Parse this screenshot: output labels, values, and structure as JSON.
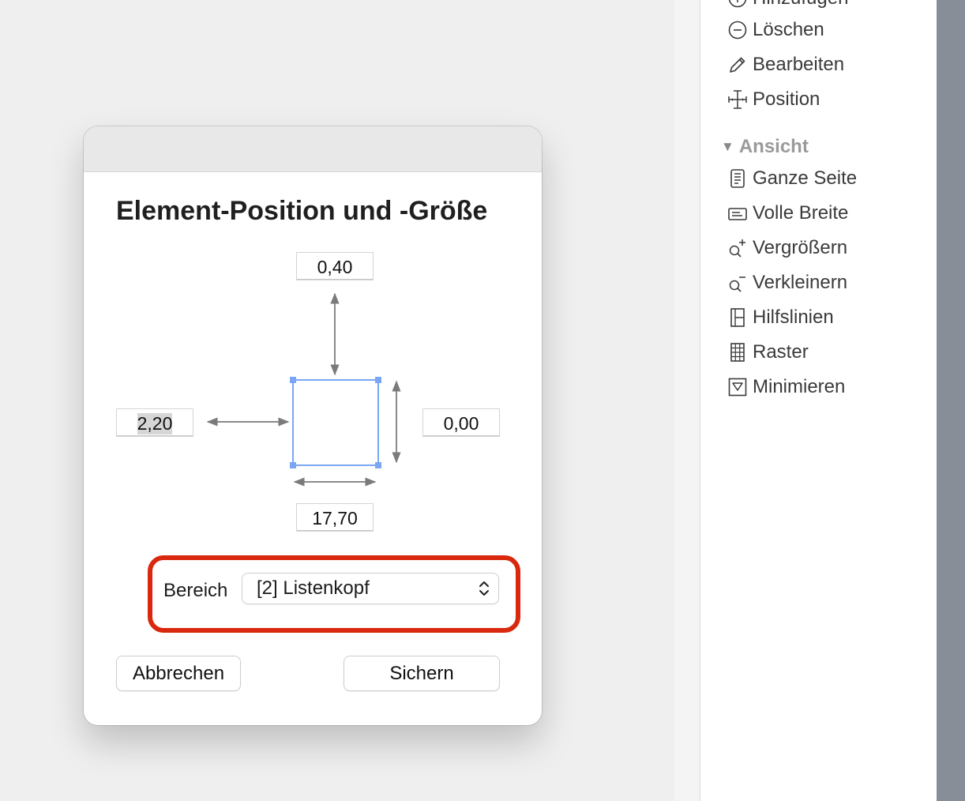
{
  "sidebar": {
    "items_top": [
      {
        "label": "Hinzufügen",
        "icon": "plus-circle-icon"
      },
      {
        "label": "Löschen",
        "icon": "minus-circle-icon"
      },
      {
        "label": "Bearbeiten",
        "icon": "pencil-icon"
      },
      {
        "label": "Position",
        "icon": "position-icon"
      }
    ],
    "section": {
      "label": "Ansicht",
      "icon": "disclosure-triangle-icon"
    },
    "items_view": [
      {
        "label": "Ganze Seite",
        "icon": "full-page-icon"
      },
      {
        "label": "Volle Breite",
        "icon": "full-width-icon"
      },
      {
        "label": "Vergrößern",
        "icon": "zoom-in-icon"
      },
      {
        "label": "Verkleinern",
        "icon": "zoom-out-icon"
      },
      {
        "label": "Hilfslinien",
        "icon": "guides-icon"
      },
      {
        "label": "Raster",
        "icon": "grid-icon"
      },
      {
        "label": "Minimieren",
        "icon": "minimize-icon"
      }
    ]
  },
  "dialog": {
    "title": "Element-Position und -Größe",
    "fields": {
      "top": "0,40",
      "left": "2,20",
      "right": "0,00",
      "bottom": "17,70"
    },
    "area": {
      "label": "Bereich",
      "value": "[2] Listenkopf"
    },
    "buttons": {
      "cancel": "Abbrechen",
      "save": "Sichern"
    }
  },
  "colors": {
    "highlight": "#d9280e",
    "selection_handle": "#7aa7f5",
    "sidebar_strip": "#878e97"
  }
}
